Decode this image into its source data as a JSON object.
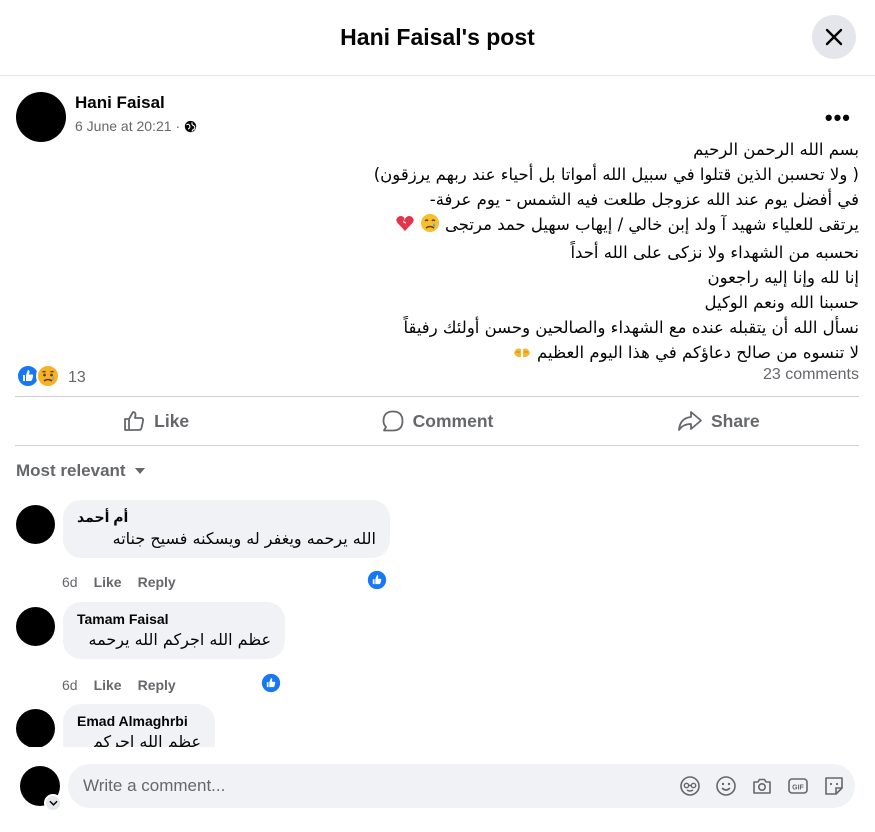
{
  "header": {
    "title": "Hani Faisal's post"
  },
  "post": {
    "author": "Hani Faisal",
    "timestamp": "6 June at 20:21",
    "meta_separator": "·",
    "privacy_icon": "globe-icon",
    "lines": [
      "بسم الله الرحمن الرحيم",
      "( ولا تحسبن الذين قتلوا في سبيل الله أمواتا بل أحياء عند ربهم يرزقون)",
      "في أفضل يوم عند الله عزوجل طلعت فيه الشمس - يوم عرفة-",
      "يرتقى للعلياء شهيد آ  ولد  إبن  خالي / إيهاب سهيل حمد مرتجى",
      "نحسبه من الشهداء ولا نزكى على الله أحداً",
      "إنا لله وإنا إليه راجعون",
      "حسبنا الله ونعم الوكيل",
      "نسأل الله أن يتقبله عنده مع الشهداء والصالحين وحسن أولئك رفيقاً",
      "لا تنسوه من صالح دعاؤكم في هذا اليوم العظيم"
    ],
    "reaction_count": "13",
    "comments_count": "23 comments"
  },
  "actions": {
    "like": "Like",
    "comment": "Comment",
    "share": "Share"
  },
  "filter": {
    "label": "Most relevant"
  },
  "comments": [
    {
      "name": "أم أحمد",
      "text": "الله يرحمه ويغفر له ويسكنه فسيح جناته",
      "age": "6d",
      "like": "Like",
      "reply": "Reply"
    },
    {
      "name": "Tamam Faisal",
      "text": "عظم الله اجركم الله يرحمه",
      "age": "6d",
      "like": "Like",
      "reply": "Reply"
    },
    {
      "name": "Emad Almaghrbi",
      "text": "عظم الله اجركم"
    }
  ],
  "composer": {
    "placeholder": "Write a comment..."
  },
  "colors": {
    "accent": "#1877f2",
    "secondary_text": "#65676b",
    "bubble": "#f0f2f5"
  }
}
